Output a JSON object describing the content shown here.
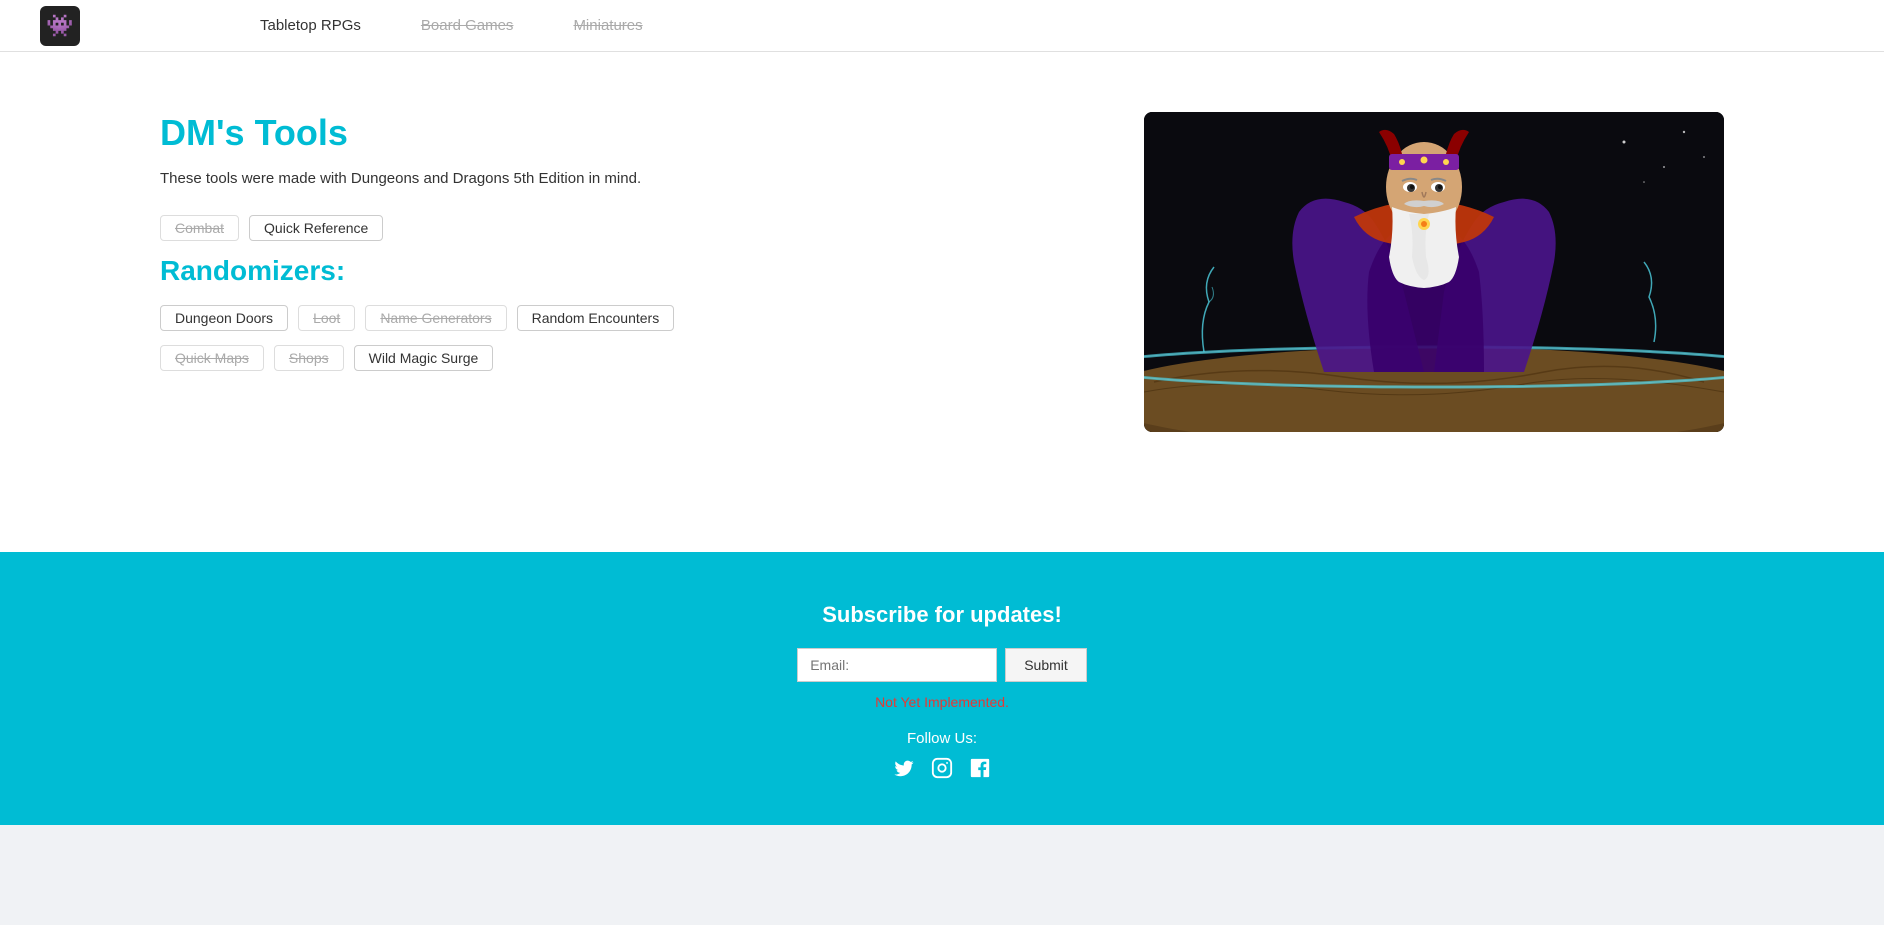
{
  "nav": {
    "logo_emoji": "👾",
    "links": [
      {
        "label": "Tabletop RPGs",
        "state": "active"
      },
      {
        "label": "Board Games",
        "state": "muted"
      },
      {
        "label": "Miniatures",
        "state": "muted"
      }
    ]
  },
  "main": {
    "title": "DM's Tools",
    "subtitle": "These tools were made with Dungeons and Dragons 5th Edition in mind.",
    "quick_tags": [
      {
        "label": "Combat",
        "strikethrough": true
      },
      {
        "label": "Quick Reference",
        "strikethrough": false
      }
    ],
    "randomizers_title": "Randomizers:",
    "randomizer_tags": [
      {
        "label": "Dungeon Doors",
        "strikethrough": false
      },
      {
        "label": "Loot",
        "strikethrough": true
      },
      {
        "label": "Name Generators",
        "strikethrough": true
      },
      {
        "label": "Random Encounters",
        "strikethrough": false
      },
      {
        "label": "Quick Maps",
        "strikethrough": true
      },
      {
        "label": "Shops",
        "strikethrough": true
      },
      {
        "label": "Wild Magic Surge",
        "strikethrough": false
      }
    ]
  },
  "footer": {
    "subscribe_title": "Subscribe for updates!",
    "email_placeholder": "Email:",
    "submit_label": "Submit",
    "not_implemented": "Not Yet Implemented.",
    "follow_label": "Follow Us:",
    "social": [
      {
        "name": "twitter",
        "icon": "🐦"
      },
      {
        "name": "instagram",
        "icon": "📷"
      },
      {
        "name": "facebook",
        "icon": "🌐"
      }
    ]
  }
}
